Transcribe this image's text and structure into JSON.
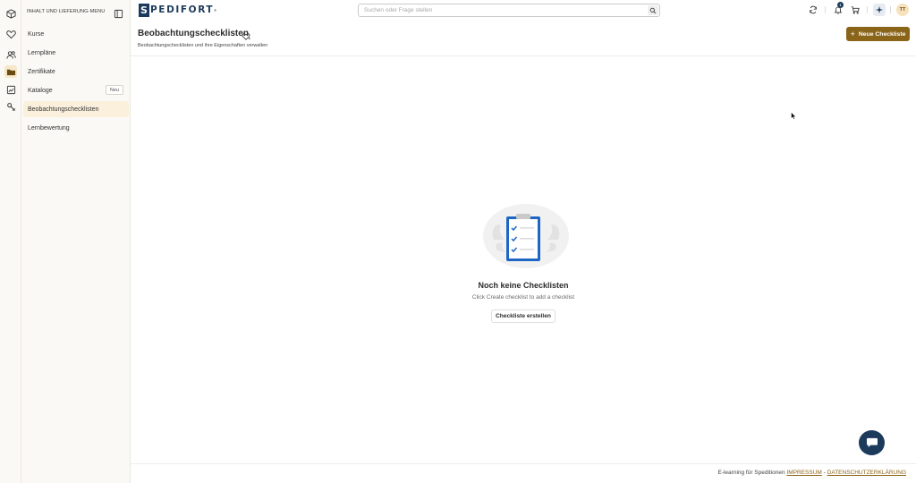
{
  "sidebar": {
    "title": "INHALT UND LIEFERUNG-MENU",
    "items": [
      {
        "label": "Kurse"
      },
      {
        "label": "Lernpläne"
      },
      {
        "label": "Zertifikate"
      },
      {
        "label": "Kataloge",
        "badge": "Neu"
      },
      {
        "label": "Beobachtungschecklisten",
        "active": true
      },
      {
        "label": "Lernbewertung"
      }
    ]
  },
  "rail": {
    "icons": [
      "cube-icon",
      "heart-icon",
      "users-icon",
      "folder-icon",
      "image-report-icon",
      "tools-icon"
    ],
    "active_index": 3
  },
  "header": {
    "logo_text": "PEDIFORT",
    "logo_mark": "S",
    "logo_reg": "®",
    "search_placeholder": "Suchen oder Frage stellen",
    "notification_count": "1",
    "avatar_initials": "TT"
  },
  "page": {
    "title": "Beobachtungschecklisten",
    "subtitle": "Beobachtungschecklisten und ihre Eigenschaften verwalten",
    "new_button_label": "Neue Checkliste"
  },
  "empty_state": {
    "title": "Noch keine Checklisten",
    "description": "Click Create checklist to add a checklist",
    "button_label": "Checkliste erstellen"
  },
  "footer": {
    "text": "E-learning für Speditionen",
    "impressum": "IMPRESSUM",
    "separator": "-",
    "datenschutz": "DATENSCHUTZERKLÄRUNG"
  },
  "colors": {
    "brand_navy": "#1c3a5b",
    "accent_gold": "#8a6418",
    "active_bg": "#fbf0dc"
  }
}
